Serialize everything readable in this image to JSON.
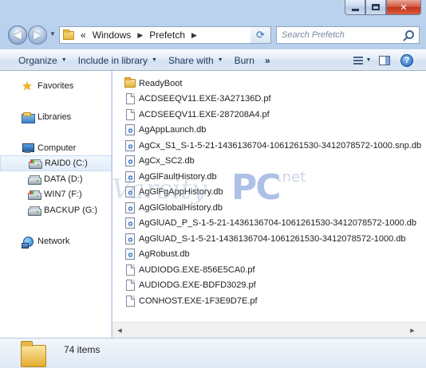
{
  "window": {
    "minimize_label": "",
    "close_label": "✕"
  },
  "address_bar": {
    "overflow": "«",
    "segments": [
      "Windows",
      "Prefetch"
    ]
  },
  "search": {
    "placeholder": "Search Prefetch"
  },
  "toolbar": {
    "organize": "Organize",
    "include_in_library": "Include in library",
    "share_with": "Share with",
    "burn": "Burn",
    "more": "»"
  },
  "nav_pane": {
    "favorites": "Favorites",
    "libraries": "Libraries",
    "computer": "Computer",
    "drives": [
      {
        "label": "RAID0 (C:)",
        "selected": true
      },
      {
        "label": "DATA (D:)",
        "selected": false
      },
      {
        "label": "WIN7 (F:)",
        "selected": false
      },
      {
        "label": "BACKUP (G:)",
        "selected": false
      }
    ],
    "network": "Network"
  },
  "files": [
    {
      "name": "ReadyBoot",
      "type": "folder"
    },
    {
      "name": "ACDSEEQV11.EXE-3A27136D.pf",
      "type": "file"
    },
    {
      "name": "ACDSEEQV11.EXE-287208A4.pf",
      "type": "file"
    },
    {
      "name": "AgAppLaunch.db",
      "type": "db"
    },
    {
      "name": "AgCx_S1_S-1-5-21-1436136704-1061261530-3412078572-1000.snp.db",
      "type": "db"
    },
    {
      "name": "AgCx_SC2.db",
      "type": "db"
    },
    {
      "name": "AgGlFaultHistory.db",
      "type": "db"
    },
    {
      "name": "AgGlFgAppHistory.db",
      "type": "db"
    },
    {
      "name": "AgGlGlobalHistory.db",
      "type": "db"
    },
    {
      "name": "AgGlUAD_P_S-1-5-21-1436136704-1061261530-3412078572-1000.db",
      "type": "db"
    },
    {
      "name": "AgGlUAD_S-1-5-21-1436136704-1061261530-3412078572-1000.db",
      "type": "db"
    },
    {
      "name": "AgRobust.db",
      "type": "db"
    },
    {
      "name": "AUDIODG.EXE-856E5CA0.pf",
      "type": "file"
    },
    {
      "name": "AUDIODG.EXE-BDFD3029.pf",
      "type": "file"
    },
    {
      "name": "CONHOST.EXE-1F3E9D7E.pf",
      "type": "file"
    }
  ],
  "details": {
    "item_count": "74 items"
  },
  "watermark": {
    "brand": "Varsity",
    "pc": "PC",
    "tld": ".net"
  },
  "colors": {
    "accent": "#2f6db5",
    "frame": "#b9cfeb"
  }
}
